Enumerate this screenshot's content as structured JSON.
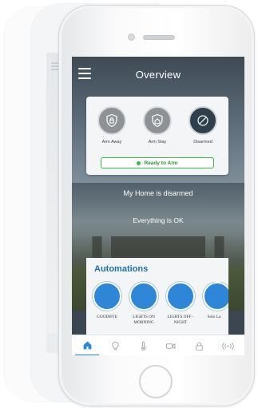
{
  "header": {
    "title": "Overview"
  },
  "arm_modes": [
    {
      "label": "Arm Away",
      "icon": "lock-shield-icon",
      "active": false
    },
    {
      "label": "Arm Stay",
      "icon": "home-shield-icon",
      "active": false
    },
    {
      "label": "Disarmed",
      "icon": "disarmed-icon",
      "active": true
    }
  ],
  "ready_status": {
    "label": "Ready to Arm",
    "color": "#3fb54a"
  },
  "home_status": {
    "main": "My Home is disarmed",
    "sub": "Everything is OK"
  },
  "automations": {
    "title": "Automations",
    "items": [
      {
        "label": "GOODBYE"
      },
      {
        "label": "LIGHTS ON MORNING"
      },
      {
        "label": "LIGHTS OFF - NIGHT"
      },
      {
        "label": "Solo La"
      }
    ]
  },
  "tabs": [
    {
      "name": "home",
      "icon": "home-icon",
      "active": true
    },
    {
      "name": "lights",
      "icon": "lightbulb-icon",
      "active": false
    },
    {
      "name": "climate",
      "icon": "thermometer-icon",
      "active": false
    },
    {
      "name": "video",
      "icon": "video-camera-icon",
      "active": false
    },
    {
      "name": "locks",
      "icon": "lock-icon",
      "active": false
    },
    {
      "name": "sensors",
      "icon": "wireless-signal-icon",
      "active": false
    }
  ],
  "colors": {
    "accent": "#2f86d6",
    "title_blue": "#1e6fae",
    "ready_green": "#3fb54a",
    "disarmed_dark": "#2f3f4c"
  }
}
